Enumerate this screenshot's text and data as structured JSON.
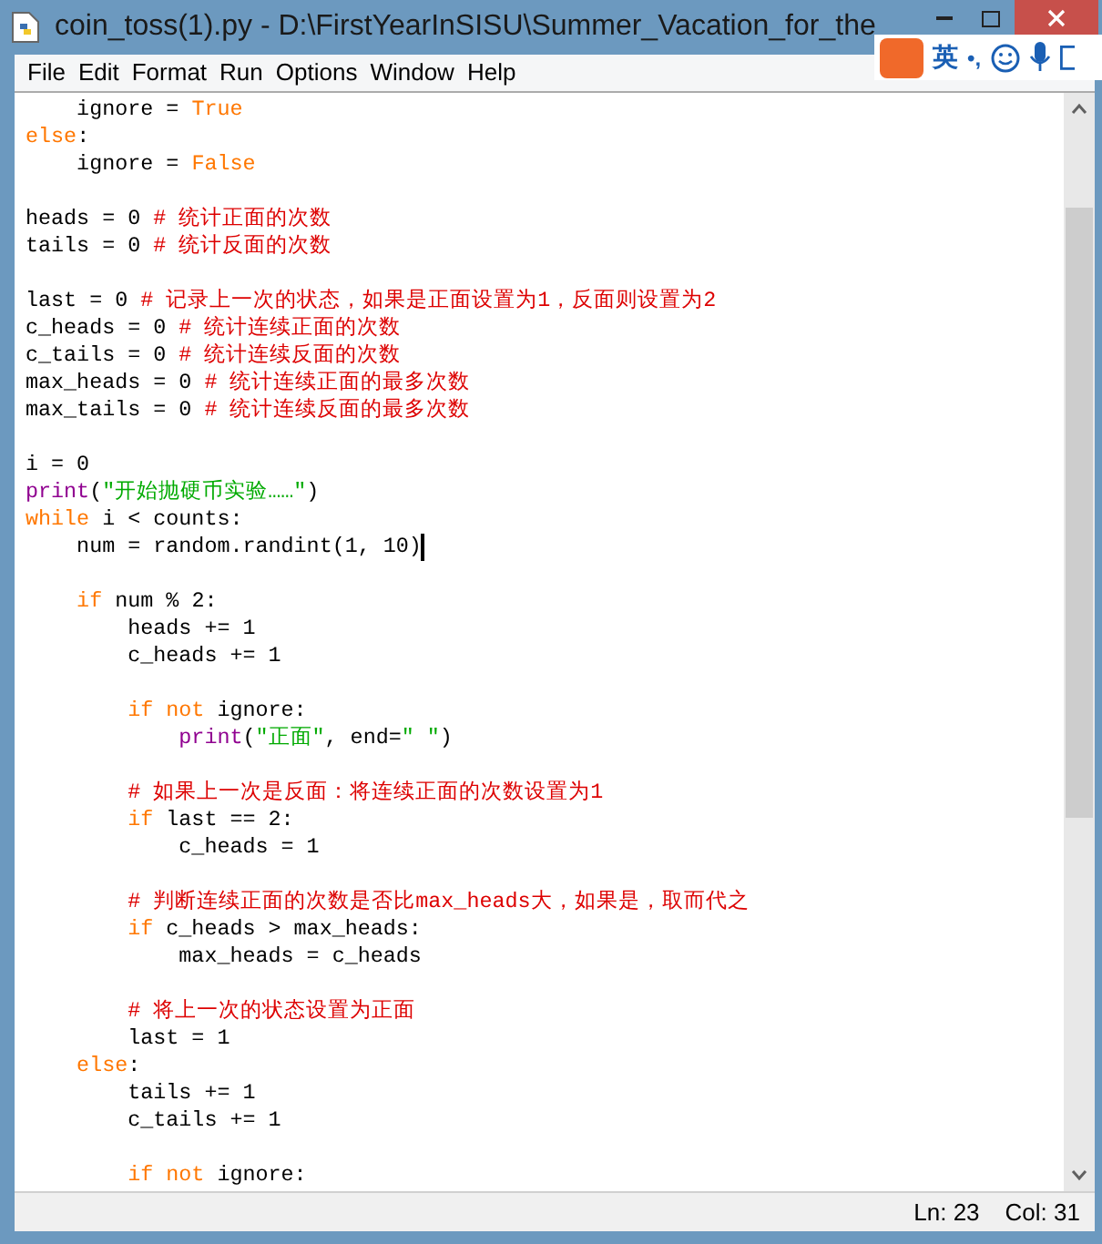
{
  "window": {
    "title": "coin_toss(1).py - D:\\FirstYearInSISU\\Summer_Vacation_for_the"
  },
  "ime_toolbar": {
    "mode": "英",
    "punctuation": "•,"
  },
  "menu": [
    "File",
    "Edit",
    "Format",
    "Run",
    "Options",
    "Window",
    "Help"
  ],
  "code_lines": [
    {
      "kind": "code",
      "tokens": [
        {
          "kind": "plain",
          "text": "    ignore = "
        },
        {
          "kind": "keyword",
          "text": "True"
        }
      ]
    },
    {
      "kind": "code",
      "tokens": [
        {
          "kind": "keyword",
          "text": "else"
        },
        {
          "kind": "plain",
          "text": ":"
        }
      ]
    },
    {
      "kind": "code",
      "tokens": [
        {
          "kind": "plain",
          "text": "    ignore = "
        },
        {
          "kind": "keyword",
          "text": "False"
        }
      ]
    },
    {
      "kind": "blank"
    },
    {
      "kind": "code",
      "tokens": [
        {
          "kind": "plain",
          "text": "heads = 0 "
        },
        {
          "kind": "comment",
          "text": "# 统计正面的次数"
        }
      ]
    },
    {
      "kind": "code",
      "tokens": [
        {
          "kind": "plain",
          "text": "tails = 0 "
        },
        {
          "kind": "comment",
          "text": "# 统计反面的次数"
        }
      ]
    },
    {
      "kind": "blank"
    },
    {
      "kind": "code",
      "tokens": [
        {
          "kind": "plain",
          "text": "last = 0 "
        },
        {
          "kind": "comment",
          "text": "# 记录上一次的状态，如果是正面设置为1，反面则设置为2"
        }
      ]
    },
    {
      "kind": "code",
      "tokens": [
        {
          "kind": "plain",
          "text": "c_heads = 0 "
        },
        {
          "kind": "comment",
          "text": "# 统计连续正面的次数"
        }
      ]
    },
    {
      "kind": "code",
      "tokens": [
        {
          "kind": "plain",
          "text": "c_tails = 0 "
        },
        {
          "kind": "comment",
          "text": "# 统计连续反面的次数"
        }
      ]
    },
    {
      "kind": "code",
      "tokens": [
        {
          "kind": "plain",
          "text": "max_heads = 0 "
        },
        {
          "kind": "comment",
          "text": "# 统计连续正面的最多次数"
        }
      ]
    },
    {
      "kind": "code",
      "tokens": [
        {
          "kind": "plain",
          "text": "max_tails = 0 "
        },
        {
          "kind": "comment",
          "text": "# 统计连续反面的最多次数"
        }
      ]
    },
    {
      "kind": "blank"
    },
    {
      "kind": "code",
      "tokens": [
        {
          "kind": "plain",
          "text": "i = 0"
        }
      ]
    },
    {
      "kind": "code",
      "tokens": [
        {
          "kind": "builtin",
          "text": "print"
        },
        {
          "kind": "plain",
          "text": "("
        },
        {
          "kind": "string",
          "text": "\"开始抛硬币实验……\""
        },
        {
          "kind": "plain",
          "text": ")"
        }
      ]
    },
    {
      "kind": "code",
      "tokens": [
        {
          "kind": "keyword",
          "text": "while"
        },
        {
          "kind": "plain",
          "text": " i < counts:"
        }
      ]
    },
    {
      "kind": "code",
      "tokens": [
        {
          "kind": "plain",
          "text": "    num = random.randint(1, 10)"
        },
        {
          "kind": "caret"
        }
      ]
    },
    {
      "kind": "blank"
    },
    {
      "kind": "code",
      "tokens": [
        {
          "kind": "keyword",
          "text": "    if"
        },
        {
          "kind": "plain",
          "text": " num % 2:"
        }
      ]
    },
    {
      "kind": "code",
      "tokens": [
        {
          "kind": "plain",
          "text": "        heads += 1"
        }
      ]
    },
    {
      "kind": "code",
      "tokens": [
        {
          "kind": "plain",
          "text": "        c_heads += 1"
        }
      ]
    },
    {
      "kind": "blank"
    },
    {
      "kind": "code",
      "tokens": [
        {
          "kind": "keyword",
          "text": "        if not"
        },
        {
          "kind": "plain",
          "text": " ignore:"
        }
      ]
    },
    {
      "kind": "code",
      "tokens": [
        {
          "kind": "builtin",
          "text": "            print"
        },
        {
          "kind": "plain",
          "text": "("
        },
        {
          "kind": "string",
          "text": "\"正面\""
        },
        {
          "kind": "plain",
          "text": ", end="
        },
        {
          "kind": "string",
          "text": "\" \""
        },
        {
          "kind": "plain",
          "text": ")"
        }
      ]
    },
    {
      "kind": "blank"
    },
    {
      "kind": "code",
      "tokens": [
        {
          "kind": "comment",
          "text": "        # 如果上一次是反面：将连续正面的次数设置为1"
        }
      ]
    },
    {
      "kind": "code",
      "tokens": [
        {
          "kind": "keyword",
          "text": "        if"
        },
        {
          "kind": "plain",
          "text": " last == 2:"
        }
      ]
    },
    {
      "kind": "code",
      "tokens": [
        {
          "kind": "plain",
          "text": "            c_heads = 1"
        }
      ]
    },
    {
      "kind": "blank"
    },
    {
      "kind": "code",
      "tokens": [
        {
          "kind": "comment",
          "text": "        # 判断连续正面的次数是否比max_heads大，如果是，取而代之"
        }
      ]
    },
    {
      "kind": "code",
      "tokens": [
        {
          "kind": "keyword",
          "text": "        if"
        },
        {
          "kind": "plain",
          "text": " c_heads > max_heads:"
        }
      ]
    },
    {
      "kind": "code",
      "tokens": [
        {
          "kind": "plain",
          "text": "            max_heads = c_heads"
        }
      ]
    },
    {
      "kind": "blank"
    },
    {
      "kind": "code",
      "tokens": [
        {
          "kind": "comment",
          "text": "        # 将上一次的状态设置为正面"
        }
      ]
    },
    {
      "kind": "code",
      "tokens": [
        {
          "kind": "plain",
          "text": "        last = 1"
        }
      ]
    },
    {
      "kind": "code",
      "tokens": [
        {
          "kind": "keyword",
          "text": "    else"
        },
        {
          "kind": "plain",
          "text": ":"
        }
      ]
    },
    {
      "kind": "code",
      "tokens": [
        {
          "kind": "plain",
          "text": "        tails += 1"
        }
      ]
    },
    {
      "kind": "code",
      "tokens": [
        {
          "kind": "plain",
          "text": "        c_tails += 1"
        }
      ]
    },
    {
      "kind": "blank"
    },
    {
      "kind": "code",
      "tokens": [
        {
          "kind": "keyword",
          "text": "        if not"
        },
        {
          "kind": "plain",
          "text": " ignore:"
        }
      ]
    }
  ],
  "status_bar": {
    "line": "Ln: 23",
    "column": "Col: 31"
  }
}
